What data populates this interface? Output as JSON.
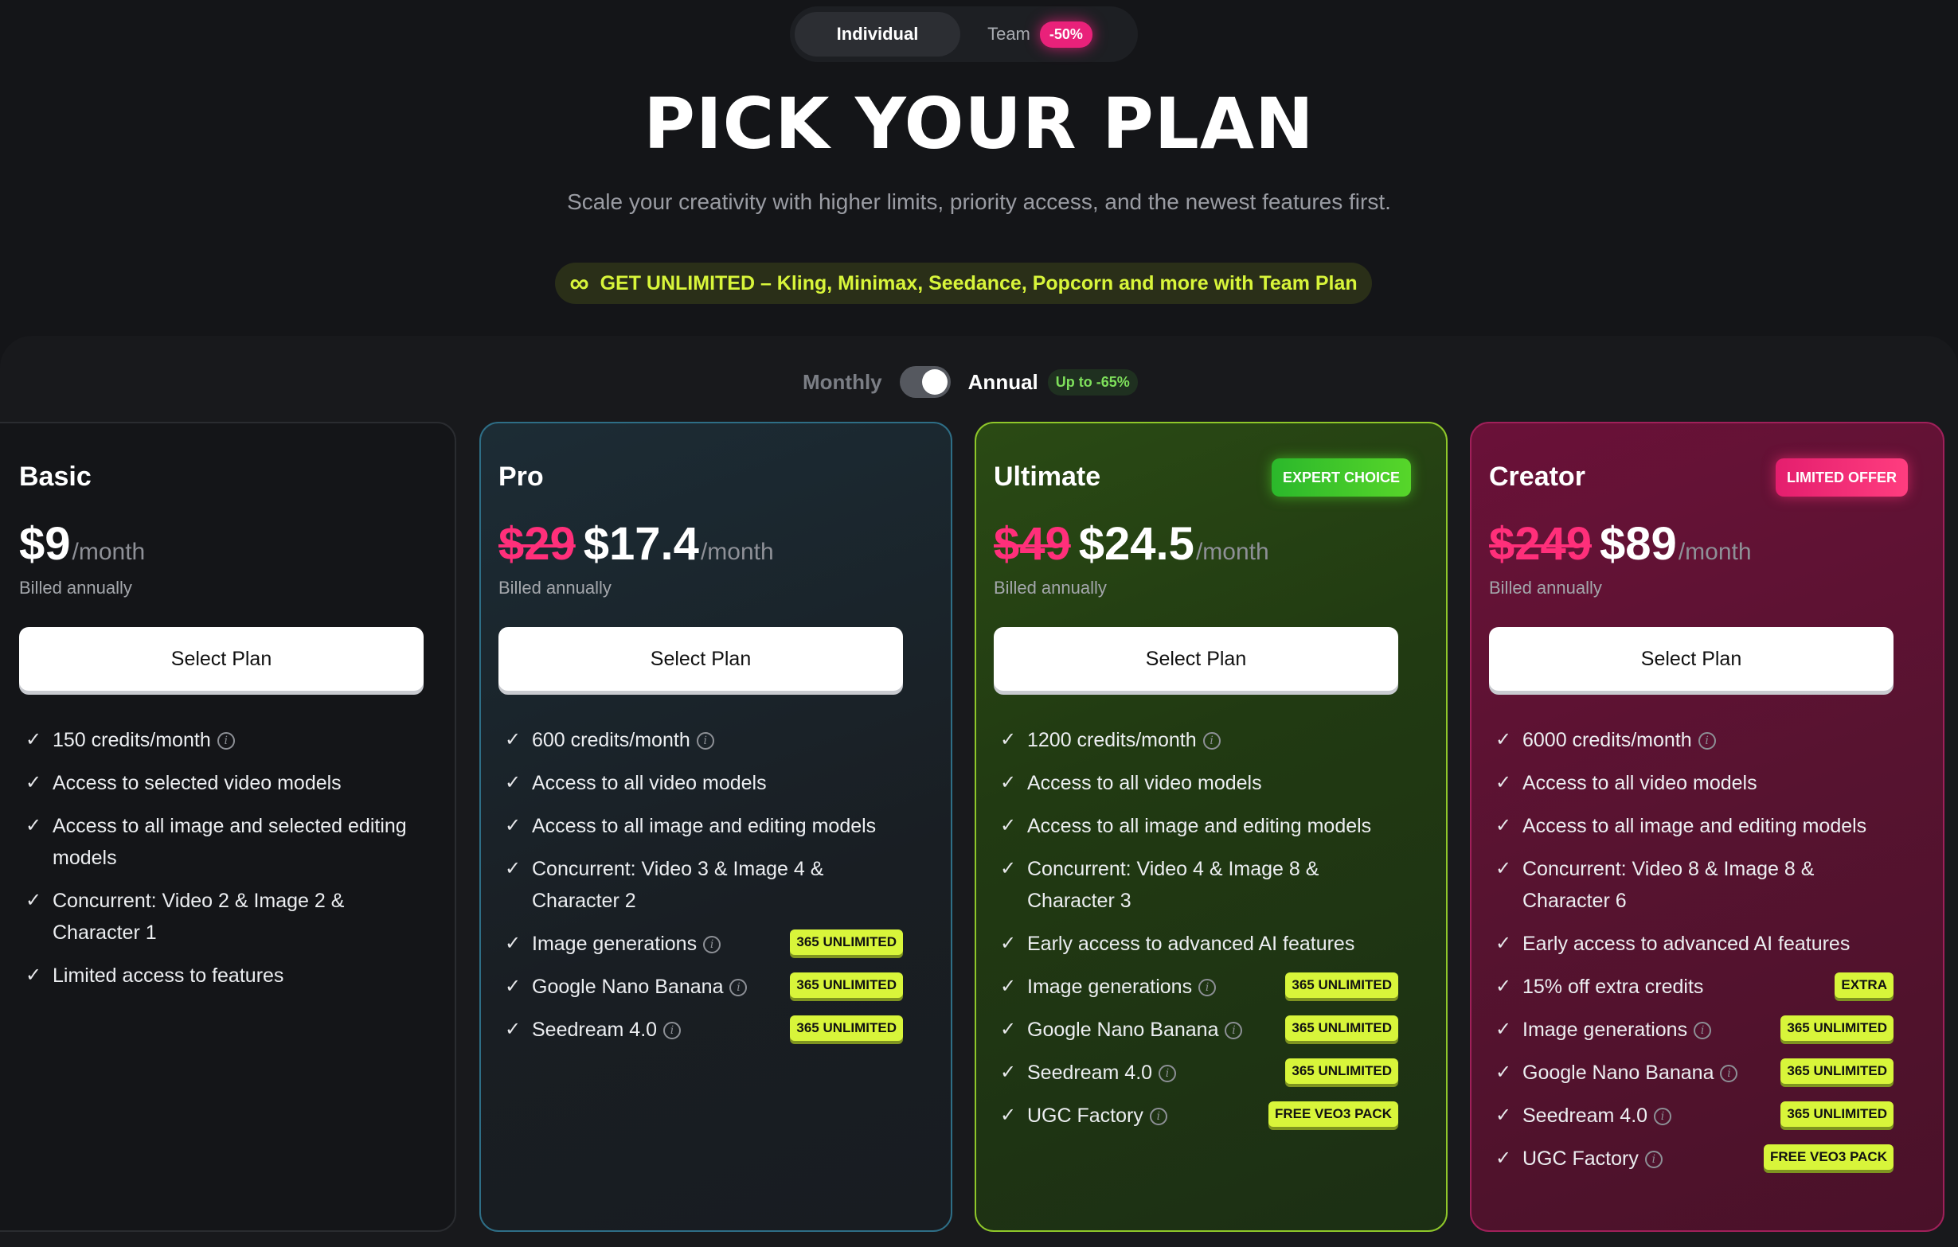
{
  "plan_type_toggle": {
    "individual_label": "Individual",
    "team_label": "Team",
    "team_discount": "-50%"
  },
  "header": {
    "title": "PICK YOUR PLAN",
    "subtitle": "Scale your creativity with higher limits, priority access, and the newest features first."
  },
  "promo": {
    "icon": "infinity-icon",
    "text": "GET UNLIMITED – Kling, Minimax, Seedance, Popcorn and more with Team Plan"
  },
  "billing": {
    "monthly_label": "Monthly",
    "annual_label": "Annual",
    "annual_savings": "Up to -65%",
    "annual_selected": true
  },
  "plans": [
    {
      "name": "Basic",
      "badge": "",
      "old_price": "",
      "price": "$9",
      "per": "/month",
      "billed": "Billed annually",
      "button": "Select Plan",
      "features": [
        {
          "text": "150 credits/month",
          "info": true,
          "tag": ""
        },
        {
          "text": "Access to selected video models",
          "info": false,
          "tag": ""
        },
        {
          "text": "Access to all image and selected editing models",
          "info": false,
          "tag": ""
        },
        {
          "text": "Concurrent: Video 2 & Image 2 & Character 1",
          "info": false,
          "tag": ""
        },
        {
          "text": "Limited access to features",
          "info": false,
          "tag": ""
        }
      ]
    },
    {
      "name": "Pro",
      "badge": "",
      "old_price": "$29",
      "price": "$17.4",
      "per": "/month",
      "billed": "Billed annually",
      "button": "Select Plan",
      "features": [
        {
          "text": "600 credits/month",
          "info": true,
          "tag": ""
        },
        {
          "text": "Access to all video models",
          "info": false,
          "tag": ""
        },
        {
          "text": "Access to all image and editing models",
          "info": false,
          "tag": ""
        },
        {
          "text": "Concurrent: Video 3 & Image 4 & Character 2",
          "info": false,
          "tag": ""
        },
        {
          "text": "Image generations",
          "info": true,
          "tag": "365 UNLIMITED"
        },
        {
          "text": "Google Nano Banana",
          "info": true,
          "tag": "365 UNLIMITED"
        },
        {
          "text": "Seedream 4.0",
          "info": true,
          "tag": "365 UNLIMITED"
        }
      ]
    },
    {
      "name": "Ultimate",
      "badge": "EXPERT CHOICE",
      "old_price": "$49",
      "price": "$24.5",
      "per": "/month",
      "billed": "Billed annually",
      "button": "Select Plan",
      "features": [
        {
          "text": "1200 credits/month",
          "info": true,
          "tag": ""
        },
        {
          "text": "Access to all video models",
          "info": false,
          "tag": ""
        },
        {
          "text": "Access to all image and editing models",
          "info": false,
          "tag": ""
        },
        {
          "text": "Concurrent: Video 4 & Image 8 & Character 3",
          "info": false,
          "tag": ""
        },
        {
          "text": "Early access to advanced AI features",
          "info": false,
          "tag": ""
        },
        {
          "text": "Image generations",
          "info": true,
          "tag": "365 UNLIMITED"
        },
        {
          "text": "Google Nano Banana",
          "info": true,
          "tag": "365 UNLIMITED"
        },
        {
          "text": "Seedream 4.0",
          "info": true,
          "tag": "365 UNLIMITED"
        },
        {
          "text": "UGC Factory",
          "info": true,
          "tag": "FREE VEO3 PACK"
        }
      ]
    },
    {
      "name": "Creator",
      "badge": "LIMITED OFFER",
      "old_price": "$249",
      "price": "$89",
      "per": "/month",
      "billed": "Billed annually",
      "button": "Select Plan",
      "features": [
        {
          "text": "6000 credits/month",
          "info": true,
          "tag": ""
        },
        {
          "text": "Access to all video models",
          "info": false,
          "tag": ""
        },
        {
          "text": "Access to all image and editing models",
          "info": false,
          "tag": ""
        },
        {
          "text": "Concurrent: Video 8 & Image 8 & Character 6",
          "info": false,
          "tag": ""
        },
        {
          "text": "Early access to advanced AI features",
          "info": false,
          "tag": ""
        },
        {
          "text": "15% off extra credits",
          "info": false,
          "tag": "EXTRA"
        },
        {
          "text": "Image generations",
          "info": true,
          "tag": "365 UNLIMITED"
        },
        {
          "text": "Google Nano Banana",
          "info": true,
          "tag": "365 UNLIMITED"
        },
        {
          "text": "Seedream 4.0",
          "info": true,
          "tag": "365 UNLIMITED"
        },
        {
          "text": "UGC Factory",
          "info": true,
          "tag": "FREE VEO3 PACK"
        }
      ]
    }
  ],
  "colors": {
    "background": "#141518",
    "accent_lime": "#d8f53a",
    "accent_pink": "#e9217a",
    "old_price": "#ff2f7a"
  }
}
